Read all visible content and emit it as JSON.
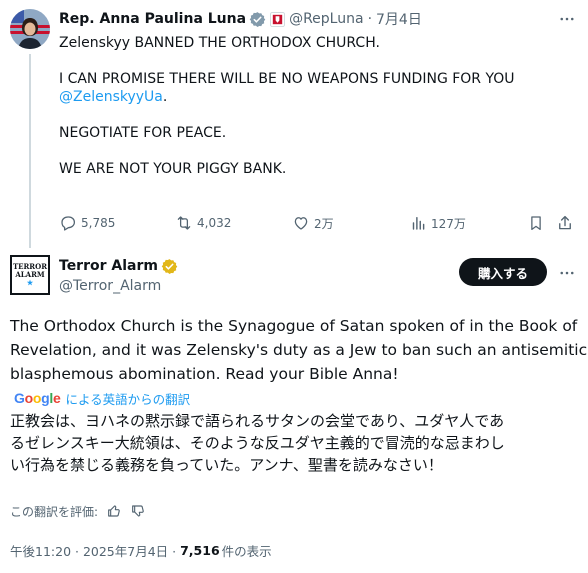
{
  "reply": {
    "display_name": "Rep. Anna Paulina Luna",
    "handle": "@RepLuna",
    "separator": "·",
    "date": "7月4日",
    "lines": [
      "Zelenskyy BANNED THE ORTHODOX CHURCH.",
      "I CAN PROMISE THERE WILL BE NO WEAPONS FUNDING FOR YOU",
      "NEGOTIATE FOR PEACE.",
      "WE ARE NOT YOUR PIGGY BANK."
    ],
    "mention": "@ZelenskyyUa",
    "mention_suffix": ".",
    "stats": {
      "replies": "5,785",
      "reposts": "4,032",
      "likes": "2万",
      "views": "127万"
    }
  },
  "main": {
    "display_name": "Terror Alarm",
    "handle": "@Terror_Alarm",
    "avatar_text": [
      "TERROR",
      "ALARM"
    ],
    "subscribe_label": "購入する",
    "body_lines": [
      "The Orthodox Church is the Synagogue of Satan spoken of in the Book of",
      "Revelation, and it was Zelensky's duty as a Jew to ban such an antisemitic",
      "blasphemous abomination. Read your Bible Anna!"
    ],
    "translated_by": "による英語からの翻訳",
    "translation_lines": [
      "正教会は、ヨハネの黙示録で語られるサタンの会堂であり、ユダヤ人であ",
      "るゼレンスキー大統領は、そのような反ユダヤ主義的で冒涜的な忌まわし",
      "い行為を禁じる義務を負っていた。アンナ、聖書を読みなさい！"
    ],
    "rate_translation": "この翻訳を評価:",
    "timestamp": "午後11:20 · 2025年7月4日 ·",
    "views_count": "7,516",
    "views_label": "件の表示"
  },
  "colors": {
    "accent": "#1d9bf0",
    "text": "#0f1419",
    "secondary": "#536471"
  }
}
